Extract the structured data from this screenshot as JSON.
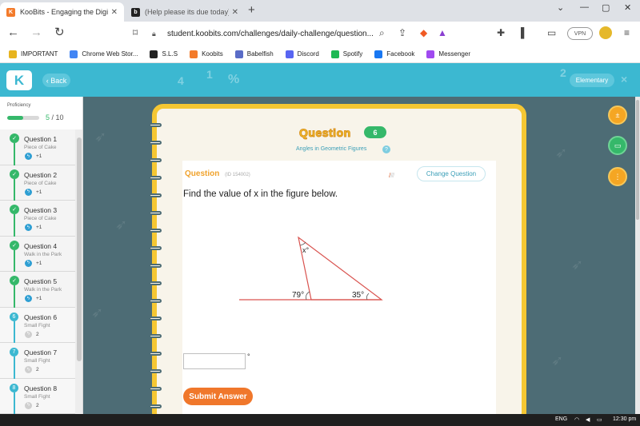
{
  "browser": {
    "tabs": [
      {
        "title": "KooBits - Engaging the Digital Mat",
        "favicon": "koobits-favicon",
        "color": "#f37b2b"
      },
      {
        "title": "(Help please its due today) - Brainly.com",
        "favicon": "brainly-favicon",
        "color": "#222222"
      }
    ],
    "close_glyph": "✕",
    "new_tab_glyph": "+",
    "url": "student.koobits.com/challenges/daily-challenge/question...",
    "vpn_label": "VPN",
    "window_controls": {
      "chevron": "⌄",
      "minimize": "—",
      "maximize": "▢",
      "close": "✕"
    }
  },
  "bookmarks": [
    {
      "label": "IMPORTANT",
      "icon": "folder-icon",
      "color": "#e7b41f"
    },
    {
      "label": "Chrome Web Stor...",
      "icon": "chrome-web-store-icon",
      "color": "#4285f4"
    },
    {
      "label": "S.L.S",
      "icon": "sls-icon",
      "color": "#222222"
    },
    {
      "label": "Koobits",
      "icon": "koobits-icon",
      "color": "#f37b2b"
    },
    {
      "label": "Babelfish",
      "icon": "babelfish-icon",
      "color": "#5a6cc7"
    },
    {
      "label": "Discord",
      "icon": "discord-icon",
      "color": "#5865f2"
    },
    {
      "label": "Spotify",
      "icon": "spotify-icon",
      "color": "#1db954"
    },
    {
      "label": "Facebook",
      "icon": "facebook-icon",
      "color": "#1877f2"
    },
    {
      "label": "Messenger",
      "icon": "messenger-icon",
      "color": "#a04af0"
    }
  ],
  "header": {
    "logo": "K",
    "back_label": "Back",
    "level_label": "Elementary"
  },
  "sidebar": {
    "proficiency_label": "Proficiency",
    "proficiency_done": "5",
    "proficiency_total": "/ 10",
    "proficiency_fraction": 0.5,
    "questions": [
      {
        "title": "Question 1",
        "subtitle": "Piece of Cake",
        "points": "+1",
        "status": "done",
        "marker": "✓"
      },
      {
        "title": "Question 2",
        "subtitle": "Piece of Cake",
        "points": "+1",
        "status": "done",
        "marker": "✓"
      },
      {
        "title": "Question 3",
        "subtitle": "Piece of Cake",
        "points": "+1",
        "status": "done",
        "marker": "✓"
      },
      {
        "title": "Question 4",
        "subtitle": "Walk in the Park",
        "points": "+1",
        "status": "done",
        "marker": "✓"
      },
      {
        "title": "Question 5",
        "subtitle": "Walk in the Park",
        "points": "+1",
        "status": "done",
        "marker": "✓"
      },
      {
        "title": "Question 6",
        "subtitle": "Small Fight",
        "points": "2",
        "status": "todo",
        "marker": "6"
      },
      {
        "title": "Question 7",
        "subtitle": "Small Fight",
        "points": "2",
        "status": "todo",
        "marker": "7"
      },
      {
        "title": "Question 8",
        "subtitle": "Small Fight",
        "points": "2",
        "status": "todo",
        "marker": "8"
      }
    ]
  },
  "question": {
    "banner": "Question",
    "number": "6",
    "topic": "Angles in Geometric Figures",
    "help": "?",
    "label": "Question",
    "id_text": "(ID 154002)",
    "difficulty_level": 1,
    "difficulty_max": 5,
    "change_label": "Change Question",
    "prompt": "Find the value of x in the figure below.",
    "figure": {
      "angle_top": "x°",
      "angle_left": "79°",
      "angle_right": "35°"
    },
    "answer_value": "",
    "degree_symbol": "°",
    "submit_label": "Submit Answer"
  },
  "taskbar": {
    "language": "ENG",
    "time": "12:30 pm"
  }
}
